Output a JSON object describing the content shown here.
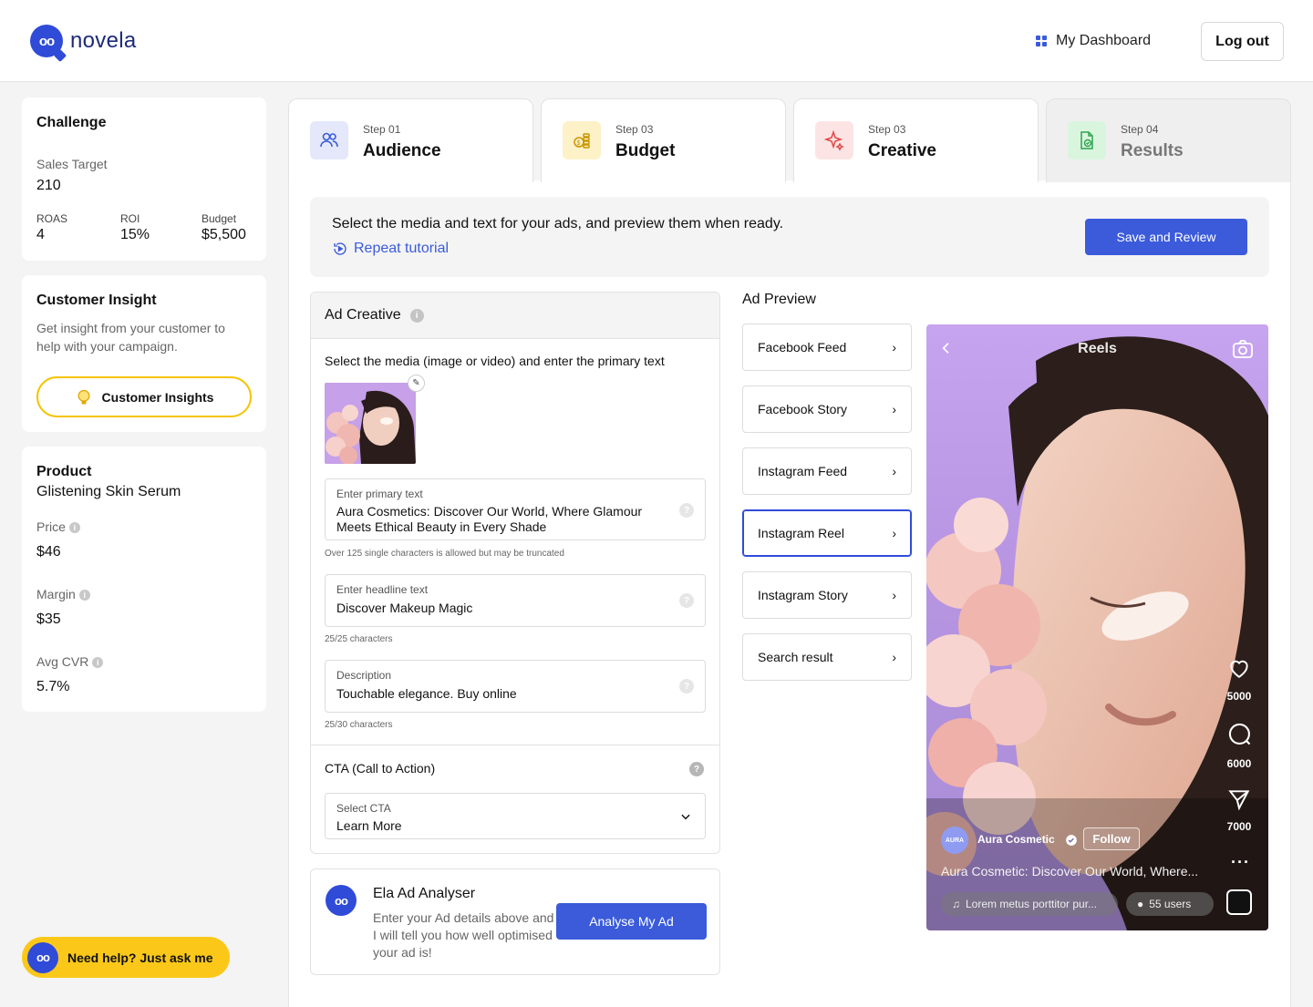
{
  "header": {
    "logo_mark": "oo",
    "logo_text": "novela",
    "dashboard_label": "My Dashboard",
    "logout_label": "Log out"
  },
  "challenge": {
    "title": "Challenge",
    "sales_target_label": "Sales Target",
    "sales_target_value": "210",
    "roas_label": "ROAS",
    "roas_value": "4",
    "roi_label": "ROI",
    "roi_value": "15%",
    "budget_label": "Budget",
    "budget_value": "$5,500"
  },
  "insight": {
    "title": "Customer Insight",
    "desc": "Get insight from your customer to help with your campaign.",
    "button_label": "Customer Insights"
  },
  "product": {
    "title": "Product",
    "name": "Glistening Skin Serum",
    "price_label": "Price",
    "price_value": "$46",
    "margin_label": "Margin",
    "margin_value": "$35",
    "cvr_label": "Avg CVR",
    "cvr_value": "5.7%"
  },
  "help_label": "Need help? Just ask me",
  "steps": [
    {
      "num": "Step 01",
      "title": "Audience"
    },
    {
      "num": "Step 03",
      "title": "Budget"
    },
    {
      "num": "Step 03",
      "title": "Creative"
    },
    {
      "num": "Step 04",
      "title": "Results"
    }
  ],
  "banner": {
    "text": "Select the media and text for your ads, and preview them when ready.",
    "repeat_label": "Repeat tutorial",
    "save_label": "Save and Review"
  },
  "ad_creative": {
    "title": "Ad Creative",
    "subtitle": "Select the media (image or video) and enter the primary text",
    "primary_label": "Enter primary text",
    "primary_value": "Aura Cosmetics: Discover Our World, Where Glamour Meets Ethical Beauty in Every Shade",
    "primary_hint": "Over 125 single characters is allowed but may be truncated",
    "headline_label": "Enter headline text",
    "headline_value": "Discover Makeup Magic",
    "headline_hint": "25/25 characters",
    "desc_label": "Description",
    "desc_value": "Touchable elegance. Buy online",
    "desc_hint": "25/30 characters",
    "cta_title": "CTA (Call to Action)",
    "cta_select_label": "Select CTA",
    "cta_select_value": "Learn More"
  },
  "analyser": {
    "title": "Ela Ad Analyser",
    "desc": "Enter your Ad details above and I will tell you how well optimised your ad is!",
    "button_label": "Analyse My Ad"
  },
  "preview": {
    "title": "Ad Preview",
    "options": [
      "Facebook Feed",
      "Facebook Story",
      "Instagram Feed",
      "Instagram Reel",
      "Instagram Story",
      "Search result"
    ],
    "active": "Instagram Reel"
  },
  "phone": {
    "title": "Reels",
    "likes": "5000",
    "comments": "6000",
    "shares": "7000",
    "avatar_text": "AURA",
    "account": "Aura Cosmetic",
    "follow": "Follow",
    "caption": "Aura Cosmetic: Discover Our World, Where...",
    "music": "Lorem metus porttitor pur...",
    "users": "55 users"
  },
  "colors": {
    "primary": "#3b5bdb",
    "accent_yellow": "#fbc81a",
    "brand_blue": "#2f4bd8"
  }
}
